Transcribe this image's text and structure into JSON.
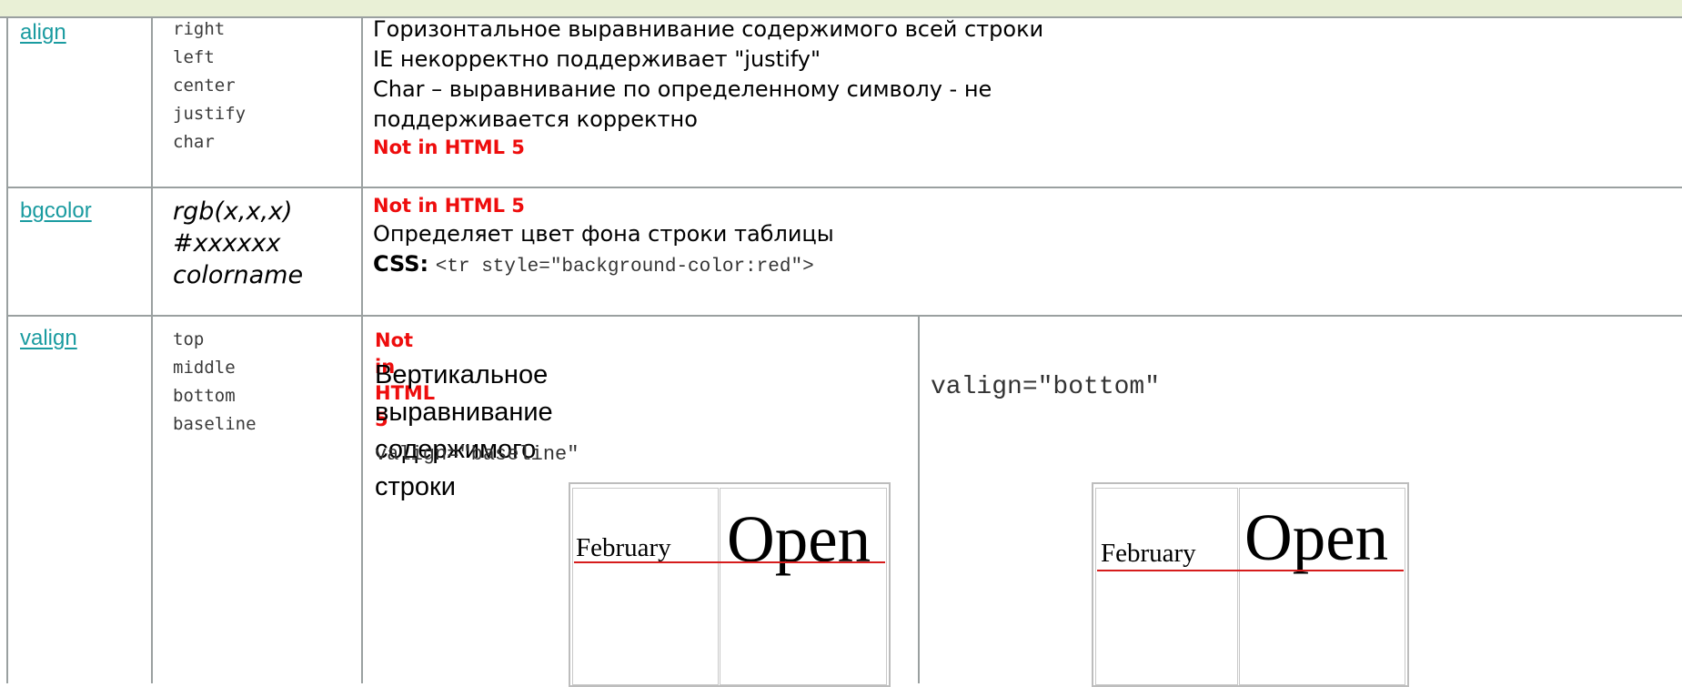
{
  "rows": [
    {
      "attr": "align",
      "values": [
        "right",
        "left",
        "center",
        "justify",
        "char"
      ],
      "desc_lines": [
        "Горизонтальное выравнивание содержимого всей строки",
        "IE некорректно поддерживает \"justify\"",
        "Char – выравнивание по определенному символу - не",
        "поддерживается корректно"
      ],
      "note": "Not in HTML 5"
    },
    {
      "attr": "bgcolor",
      "values": [
        "rgb(x,x,x)",
        "#xxxxxx",
        "colorname"
      ],
      "note": "Not in HTML 5",
      "desc": "Определяет цвет фона строки таблицы",
      "css_label": "CSS:",
      "css_code": "<tr style=\"background-color:red\">"
    },
    {
      "attr": "valign",
      "values": [
        "top",
        "middle",
        "bottom",
        "baseline"
      ],
      "note": "Not in HTML 5",
      "desc_lines": [
        "Вертикальное выравнивание",
        "содержимого строки"
      ],
      "example_baseline": "valign=\"baseline\"",
      "example_bottom": "valign=\"bottom\"",
      "demo_word_small": "February",
      "demo_word_big": "Open"
    }
  ],
  "colors": {
    "link": "#1a9ba0",
    "note_red": "#ee0d0d",
    "grid": "#9aa0a0",
    "header_strip": "#e9f0d6"
  }
}
